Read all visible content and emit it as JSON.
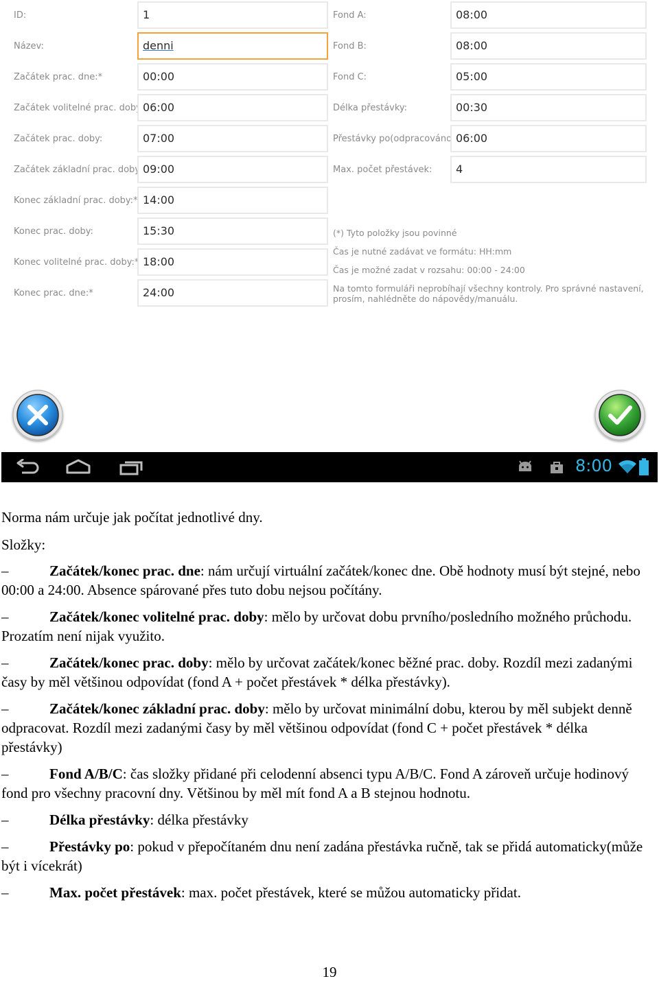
{
  "form": {
    "left": [
      {
        "label": "ID:",
        "value": "1"
      },
      {
        "label": "Název:",
        "value": "denni"
      },
      {
        "label": "Začátek prac. dne:*",
        "value": "00:00"
      },
      {
        "label": "Začátek volitelné prac. doby:*",
        "value": "06:00"
      },
      {
        "label": "Začátek prac. doby:",
        "value": "07:00"
      },
      {
        "label": "Začátek základní prac. doby:*",
        "value": "09:00"
      },
      {
        "label": "Konec základní prac. doby:*",
        "value": "14:00"
      },
      {
        "label": "Konec prac. doby:",
        "value": "15:30"
      },
      {
        "label": "Konec volitelné prac. doby:*",
        "value": "18:00"
      },
      {
        "label": "Konec prac. dne:*",
        "value": "24:00"
      }
    ],
    "right": [
      {
        "label": "Fond A:",
        "value": "08:00"
      },
      {
        "label": "Fond B:",
        "value": "08:00"
      },
      {
        "label": "Fond C:",
        "value": "05:00"
      },
      {
        "label": "Délka přestávky:",
        "value": "00:30"
      },
      {
        "label": "Přestávky po(odpracováno):",
        "value": "06:00"
      },
      {
        "label": "Max. počet přestávek:",
        "value": "4"
      }
    ],
    "notes": {
      "required": "(*) Tyto položky jsou povinné",
      "format": "Čas je nutné zadávat ve formátu: HH:mm",
      "range": "Čas je možné zadat v rozsahu: 00:00 - 24:00",
      "warning_line1": "Na tomto formuláři neprobíhají všechny kontroly. Pro správné nastavení,",
      "warning_line2": "prosím, nahlédněte do nápovědy/manuálu."
    }
  },
  "buttons": {
    "cancel_icon": "close-x-icon",
    "confirm_icon": "checkmark-icon",
    "cancel_color": "#2a8fe0",
    "confirm_color": "#3aa83a"
  },
  "navbar": {
    "time": "8:00",
    "accent": "#33b5e5",
    "icons": [
      "back-icon",
      "home-icon",
      "recent-apps-icon",
      "android-debug-icon",
      "shopping-bag-icon",
      "wifi-icon",
      "battery-icon"
    ]
  },
  "doc": {
    "intro": "Norma nám určuje jak počítat jednotlivé dny.",
    "components_title": "Složky:",
    "dash": "–",
    "items": [
      {
        "term": "Začátek/konec prac. dne",
        "text": ": nám určují virtuální začátek/konec dne. Obě hodnoty musí být stejné, nebo 00:00 a 24:00. Absence spárované přes tuto dobu nejsou počítány."
      },
      {
        "term": "Začátek/konec volitelné prac. doby",
        "text": ": mělo by určovat dobu prvního/posledního možného průchodu. Prozatím není nijak využito."
      },
      {
        "term": "Začátek/konec prac. doby",
        "text": ": mělo by určovat začátek/konec běžné prac. doby. Rozdíl mezi zadanými časy by měl většinou odpovídat (fond A + počet přestávek * délka přestávky)."
      },
      {
        "term": "Začátek/konec základní prac. doby",
        "text": ": mělo by určovat minimální dobu, kterou by měl subjekt denně odpracovat. Rozdíl mezi zadanými časy by měl většinou odpovídat (fond C + počet přestávek * délka přestávky)"
      },
      {
        "term": "Fond A/B/C",
        "text": ": čas složky přidané při celodenní absenci typu A/B/C. Fond A zároveň určuje hodinový fond pro všechny pracovní dny. Většinou by měl mít fond A a B stejnou hodnotu."
      },
      {
        "term": "Délka přestávky",
        "text": ": délka přestávky"
      },
      {
        "term": "Přestávky po",
        "text": ": pokud v přepočítaném dnu není zadána přestávka ručně, tak se přidá automaticky(může být i vícekrát)"
      },
      {
        "term": "Max. počet přestávek",
        "text": ": max. počet přestávek, které se můžou automaticky přidat."
      }
    ],
    "page_number": "19"
  }
}
